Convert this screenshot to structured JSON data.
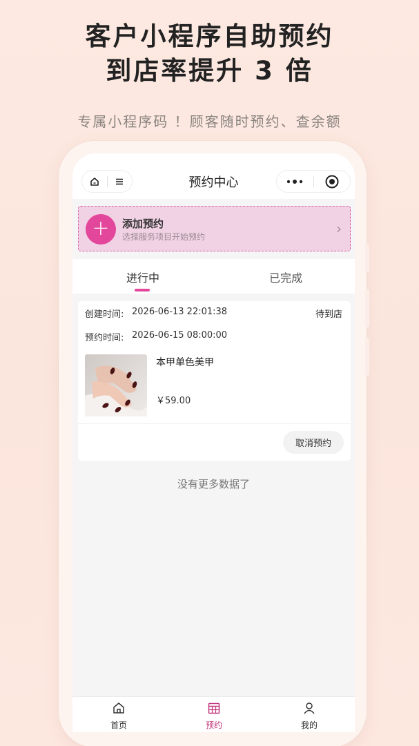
{
  "promo": {
    "headline_line1": "客户小程序自助预约",
    "headline_line2": "到店率提升 3 倍",
    "subtitle": "专属小程序码 ！顾客随时预约、查余额"
  },
  "navbar": {
    "title": "预约中心",
    "icons": [
      "home-icon",
      "menu-icon",
      "more-icon",
      "target-icon"
    ]
  },
  "add_appointment": {
    "title": "添加预约",
    "subtitle": "选择服务项目开始预约",
    "plus": "+",
    "chevron": "›"
  },
  "tabs": [
    {
      "label": "进行中",
      "active": true
    },
    {
      "label": "已完成",
      "active": false
    }
  ],
  "order": {
    "created_label": "创建时间:",
    "created_value": "2026-06-13 22:01:38",
    "status": "待到店",
    "appointment_label": "预约时间:",
    "appointment_value": "2026-06-15 08:00:00",
    "product_name": "本甲单色美甲",
    "price": "￥59.00",
    "cancel_label": "取消预约"
  },
  "no_more": "没有更多数据了",
  "tabbar": [
    {
      "label": "首页",
      "icon": "home-icon",
      "active": false
    },
    {
      "label": "预约",
      "icon": "calendar-icon",
      "active": true
    },
    {
      "label": "我的",
      "icon": "user-icon",
      "active": false
    }
  ],
  "colors": {
    "accent": "#e2479b",
    "accent_bg": "#f1d2e4",
    "page_bg": "#fbe6dd"
  }
}
